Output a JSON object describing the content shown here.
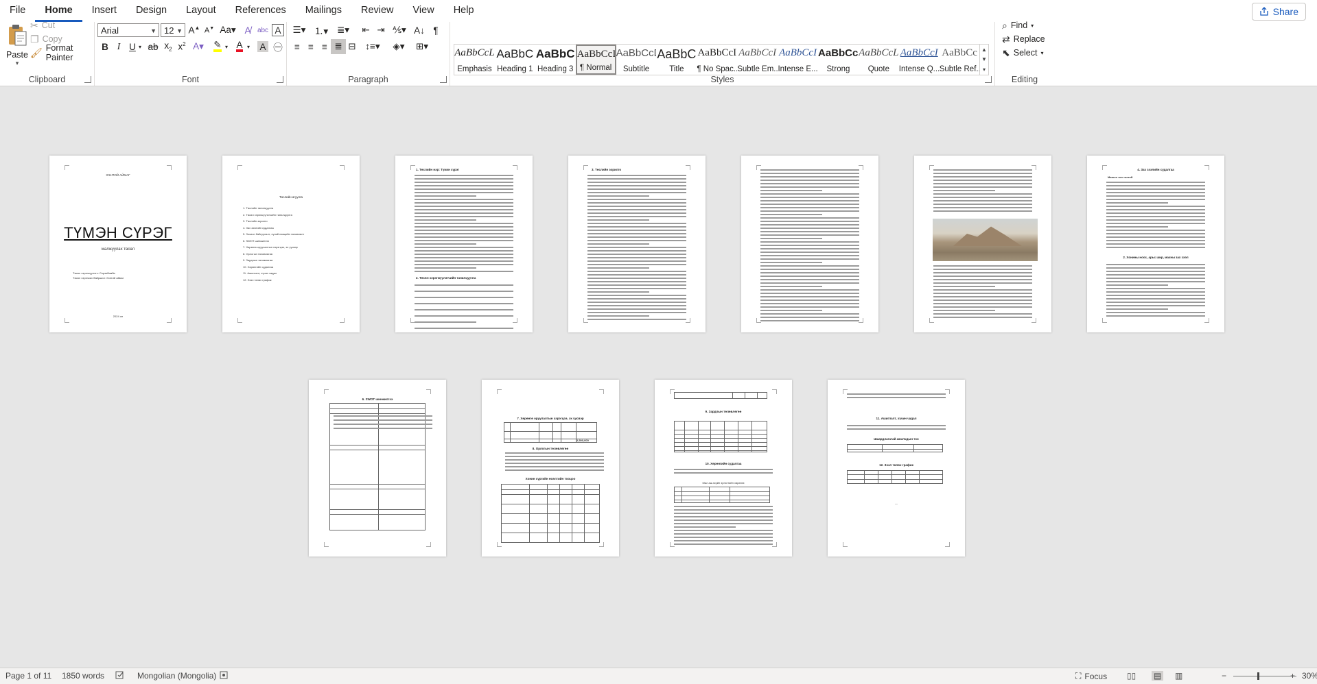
{
  "menu": {
    "tabs": [
      "File",
      "Home",
      "Insert",
      "Design",
      "Layout",
      "References",
      "Mailings",
      "Review",
      "View",
      "Help"
    ],
    "active": "Home",
    "share_label": "Share"
  },
  "ribbon": {
    "clipboard": {
      "label": "Clipboard",
      "paste": "Paste",
      "cut": "Cut",
      "copy": "Copy",
      "format_painter": "Format Painter"
    },
    "font": {
      "label": "Font",
      "font_name": "Arial",
      "font_size": "12"
    },
    "paragraph": {
      "label": "Paragraph"
    },
    "styles": {
      "label": "Styles",
      "items": [
        {
          "preview": "AaBbCcL",
          "name": "Emphasis",
          "style": "italic"
        },
        {
          "preview": "AaBbC",
          "name": "Heading 1",
          "style": "h1"
        },
        {
          "preview": "AaBbC",
          "name": "Heading 3",
          "style": "h3"
        },
        {
          "preview": "AaBbCcI",
          "name": "¶ Normal",
          "style": "normal"
        },
        {
          "preview": "AaBbCcD",
          "name": "Subtitle",
          "style": "subtitle"
        },
        {
          "preview": "AaBbC",
          "name": "Title",
          "style": "title"
        },
        {
          "preview": "AaBbCcI",
          "name": "¶ No Spac...",
          "style": "normal"
        },
        {
          "preview": "AaBbCcI",
          "name": "Subtle Em...",
          "style": "subtle"
        },
        {
          "preview": "AaBbCcI",
          "name": "Intense E...",
          "style": "intense"
        },
        {
          "preview": "AaBbCcl",
          "name": "Strong",
          "style": "strong"
        },
        {
          "preview": "AaBbCcL",
          "name": "Quote",
          "style": "quote"
        },
        {
          "preview": "AaBbCcI",
          "name": "Intense Q...",
          "style": "intenseq"
        },
        {
          "preview": "AaBbCc",
          "name": "Subtle Ref...",
          "style": "subtleref"
        }
      ],
      "selected_index": 3
    },
    "editing": {
      "label": "Editing",
      "find": "Find",
      "replace": "Replace",
      "select": "Select"
    }
  },
  "pages": {
    "p1": {
      "top_text": "ХЭНТИЙ АЙМАГ",
      "title": "ТҮМЭН СҮРЭГ",
      "subtitle": "малжуулах төсөл",
      "author1": "Төсөл хэрэгжүүлэгч: Сэрээбямба",
      "author2": "Төсөл хэрэгжих байршил: Хэнтий аймаг",
      "year": "2024 он"
    },
    "p2": {
      "heading": "Төслийн агуулга",
      "toc": [
        "1. Төслийн танилцуулга",
        "2. Төсөл хэрэгжүүлэгчийн танилцуулга",
        "3. Төслийн зорилго",
        "4. Зах зээлийн судалгаа",
        "5. Зохион байгуулалт, хүний нөөцийн төлөвлөлт",
        "6. SWOT шинжилгээ",
        "7. Хөрөнгө оруулалтын хэрэгцээ, эх үүсвэр",
        "8. Орлогын төлөвлөгөө",
        "9. Зардлын төлөвлөгөө",
        "10. Хөрөнгийн судалгаа",
        "11. Ашиглалт, хүчин чадал",
        "12. Зээл төлөх график"
      ]
    },
    "p3": {
      "heading": "1. Төслийн нэр: Түмэн сүрэг",
      "heading2": "2. Төсөл хэрэгжүүлэгчийн танилцуулга"
    },
    "p4": {
      "heading": "3. Төслийн зорилго"
    },
    "p7": {
      "heading": "4. Зах зээлийн судалгаа",
      "sub1": "Малын тоо толгой",
      "sub2": "2. Хонины ноос, арьс шир, махны зах зээл"
    },
    "p8": {
      "heading": "6. SWOT шинжилгээ"
    },
    "p9": {
      "heading": "7. Хөрөнгө оруулалтын хэрэгцээ, эх үүсвэр",
      "heading2": "8. Орлогын төлөвлөгөө",
      "table_title": "Хонин сүргийн өсөлтийн тооцоо",
      "total": "2,500,000"
    },
    "p10": {
      "heading": "9. Зардлын төлөвлөгөө",
      "heading2": "10. Хөрөнгийн судалгаа",
      "caption": "Мал аж ахуйн эргэлтийн хөрөнгө"
    },
    "p11": {
      "heading": "11. Ашиглалт, хүчин чадал",
      "sub": "Шаардлагатай ажилчдын тоо",
      "heading2": "12. Зээл төлөх график",
      "page_num": "—"
    }
  },
  "status": {
    "page": "Page 1 of 11",
    "words": "1850 words",
    "language": "Mongolian (Mongolia)",
    "focus": "Focus",
    "zoom": "30%"
  }
}
